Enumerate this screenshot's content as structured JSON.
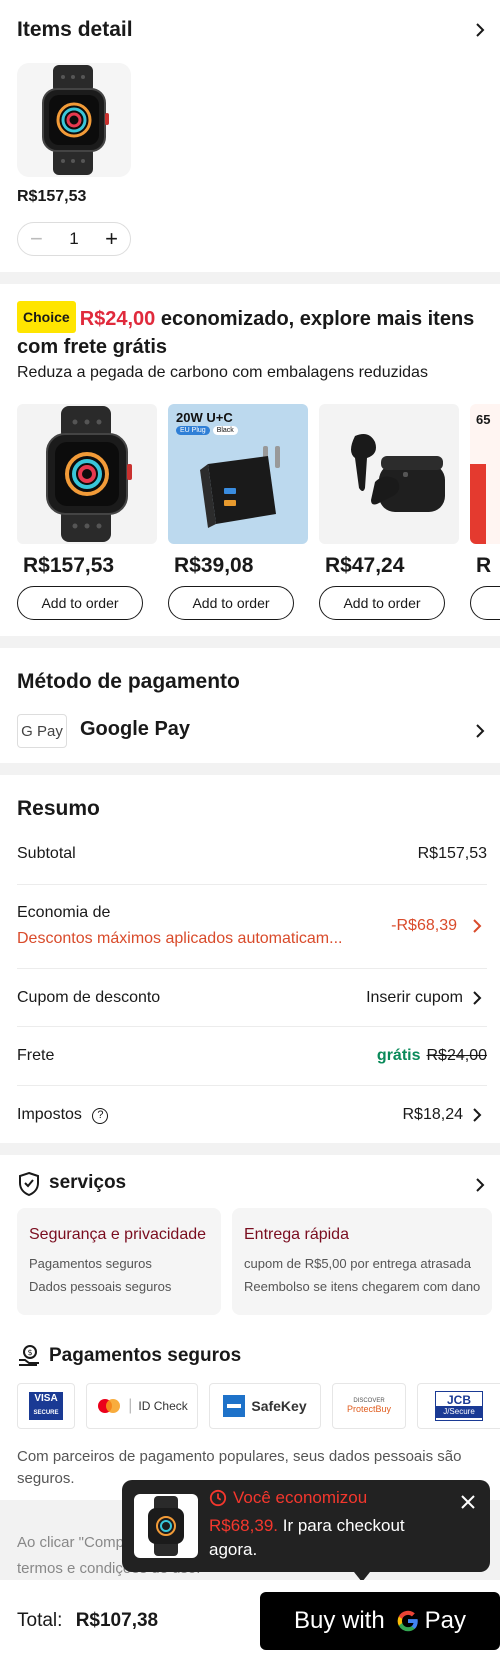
{
  "items_detail": {
    "title": "Items detail",
    "price": "R$157,53",
    "quantity": "1"
  },
  "choice": {
    "badge": "Choice",
    "saved_amount": "R$24,00",
    "title_rest": " economizado, explore mais itens com frete grátis",
    "subtitle": "Reduza a pegada de carbono com embalagens reduzidas",
    "products": [
      {
        "price": "R$157,53",
        "button": "Add to order",
        "image_icon": "smartwatch-image"
      },
      {
        "price": "R$39,08",
        "button": "Add to order",
        "image_icon": "charger-image",
        "image_text": "20W U+C",
        "image_tag1": "EU Plug",
        "image_tag2": "Black"
      },
      {
        "price": "R$47,24",
        "button": "Add to order",
        "image_icon": "earbuds-image"
      },
      {
        "price": "R",
        "button": "",
        "image_icon": "cable-image",
        "image_text": "65"
      }
    ]
  },
  "payment": {
    "title": "Método de pagamento",
    "method_badge": "G Pay",
    "method": "Google Pay"
  },
  "summary": {
    "title": "Resumo",
    "subtotal_label": "Subtotal",
    "subtotal_value": "R$157,53",
    "savings_label": "Economia de",
    "savings_note": "Descontos máximos aplicados automaticam...",
    "savings_value": "-R$68,39",
    "coupon_label": "Cupom de desconto",
    "coupon_value": "Inserir cupom",
    "shipping_label": "Frete",
    "shipping_free": "grátis",
    "shipping_old": "R$24,00",
    "taxes_label": "Impostos",
    "taxes_value": "R$18,24"
  },
  "services": {
    "title": "serviços",
    "cards": [
      {
        "title": "Segurança e privacidade",
        "lines": [
          "Pagamentos seguros",
          "Dados pessoais seguros"
        ]
      },
      {
        "title": "Entrega rápida",
        "lines": [
          "cupom de R$5,00 por entrega atrasada",
          "Reembolso se itens chegarem com dano"
        ]
      }
    ]
  },
  "secure_payments": {
    "title": "Pagamentos seguros",
    "logos": [
      {
        "name": "VISA",
        "sub": "SECURE"
      },
      {
        "name": "ID Check"
      },
      {
        "name": "SafeKey"
      },
      {
        "name": "ProtectBuy",
        "sub": "DISCOVER"
      },
      {
        "name": "JCB",
        "sub": "J/Secure"
      }
    ],
    "note": "Com parceiros de pagamento populares, seus dados pessoais são seguros."
  },
  "legal": {
    "text": "Ao clicar \"Comprar agora\", eu afirmo que li e estou de acordo com os termos e condições de uso."
  },
  "toast": {
    "headline": "Você economizou",
    "amount": "R$68,39.",
    "message": " Ir para checkout agora."
  },
  "footer": {
    "total_label": "Total:",
    "total_value": "R$107,38",
    "buy_prefix": "Buy with",
    "buy_suffix": "Pay"
  },
  "colors": {
    "accent_red": "#e02a3c",
    "free_green": "#0a8a5a",
    "choice_yellow": "#ffe500"
  }
}
